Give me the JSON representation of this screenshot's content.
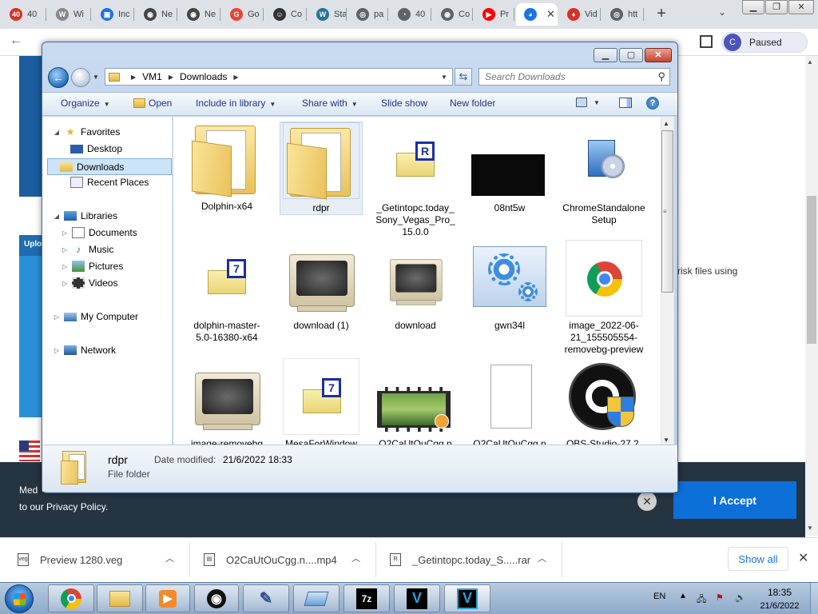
{
  "browser": {
    "tabs": [
      {
        "label": "40",
        "fav": "40",
        "color": "#d93025"
      },
      {
        "label": "Wi",
        "fav": "W",
        "color": "#888888"
      },
      {
        "label": "Inc",
        "fav": "▣",
        "color": "#1a73e8"
      },
      {
        "label": "Ne",
        "fav": "◉",
        "color": "#444444"
      },
      {
        "label": "Ne",
        "fav": "◉",
        "color": "#444444"
      },
      {
        "label": "Go",
        "fav": "G",
        "color": "#ea4335"
      },
      {
        "label": "Co",
        "fav": "☺",
        "color": "#333333"
      },
      {
        "label": "Sta",
        "fav": "W",
        "color": "#21759b"
      },
      {
        "label": "pa",
        "fav": "◎",
        "color": "#5f6368"
      },
      {
        "label": "40",
        "fav": "◔",
        "color": "#5f6368"
      },
      {
        "label": "Co",
        "fav": "◉",
        "color": "#5f6368"
      },
      {
        "label": "Pr",
        "fav": "▶",
        "color": "#ff0000"
      },
      {
        "label": "",
        "fav": "◕",
        "color": "#1a73e8",
        "active": true
      },
      {
        "label": "Vid",
        "fav": "♦",
        "color": "#d93025"
      },
      {
        "label": "htt",
        "fav": "◎",
        "color": "#5f6368"
      }
    ],
    "new_tab_label": "+",
    "profile_initial": "C",
    "profile_status": "Paused"
  },
  "webpage": {
    "side_label": "Uplo",
    "text_fragment": "risk files using",
    "cookie_line1": "Med",
    "cookie_line2": "to our Privacy Policy.",
    "accept_label": "I Accept"
  },
  "explorer": {
    "breadcrumb": [
      "VM1",
      "Downloads"
    ],
    "search_placeholder": "Search Downloads",
    "commands": {
      "organize": "Organize",
      "open": "Open",
      "include_in_library": "Include in library",
      "share_with": "Share with",
      "slide_show": "Slide show",
      "new_folder": "New folder"
    },
    "nav": {
      "favorites": "Favorites",
      "desktop": "Desktop",
      "downloads": "Downloads",
      "recent_places": "Recent Places",
      "libraries": "Libraries",
      "documents": "Documents",
      "music": "Music",
      "pictures": "Pictures",
      "videos": "Videos",
      "my_computer": "My Computer",
      "network": "Network"
    },
    "items": [
      {
        "name": "Dolphin-x64",
        "icon": "folder-icon"
      },
      {
        "name": "rdpr",
        "icon": "folder-icon"
      },
      {
        "name": "_Getintopc.today_Sony_Vegas_Pro_15.0.0",
        "icon": "rar-archive-icon"
      },
      {
        "name": "08nt5w",
        "icon": "image-thumbnail-icon"
      },
      {
        "name": "ChromeStandaloneSetup",
        "icon": "setup-icon"
      },
      {
        "name": "dolphin-master-5.0-16380-x64",
        "icon": "7z-archive-icon"
      },
      {
        "name": "download (1)",
        "icon": "crt-image-icon"
      },
      {
        "name": "download",
        "icon": "crt-image-icon"
      },
      {
        "name": "gwn34l",
        "icon": "gear-image-icon"
      },
      {
        "name": "image_2022-06-21_155505554-removebg-preview",
        "icon": "chrome-image-icon"
      },
      {
        "name": "image-removebg",
        "icon": "crt-image-icon"
      },
      {
        "name": "MesaForWindow",
        "icon": "7z-archive-icon"
      },
      {
        "name": "O2CaUtOuCgg.n",
        "icon": "video-icon"
      },
      {
        "name": "O2CaUtOuCgg.n",
        "icon": "blank-file-icon"
      },
      {
        "name": "OBS-Studio-27.2.",
        "icon": "obs-installer-icon"
      }
    ],
    "details": {
      "name": "rdpr",
      "type": "File folder",
      "date_label": "Date modified:",
      "date_value": "21/6/2022 18:33"
    }
  },
  "downloads_shelf": {
    "items": [
      {
        "name": "Preview 1280.veg",
        "badge": "veg"
      },
      {
        "name": "O2CaUtOuCgg.n....mp4",
        "badge": "▤"
      },
      {
        "name": "_Getintopc.today_S.....rar",
        "badge": "R"
      }
    ],
    "show_all": "Show all"
  },
  "taskbar": {
    "apps": [
      {
        "name": "chrome",
        "glyph": "",
        "color": "#4285f4"
      },
      {
        "name": "explorer",
        "glyph": "",
        "color": "#e3b94a"
      },
      {
        "name": "media-player",
        "glyph": "▶",
        "color": "#f38b2a"
      },
      {
        "name": "obs",
        "glyph": "◉",
        "color": "#111111"
      },
      {
        "name": "pen-tool",
        "glyph": "✎",
        "color": "#2f4f8f"
      },
      {
        "name": "notepad",
        "glyph": "▭",
        "color": "#6aa0d8"
      },
      {
        "name": "7zip",
        "glyph": "7z",
        "color": "#000000"
      },
      {
        "name": "vegas-1",
        "glyph": "V",
        "color": "#2a9fd8"
      },
      {
        "name": "vegas-2",
        "glyph": "V",
        "color": "#2a9fd8"
      }
    ],
    "lang": "EN",
    "time": "18:35",
    "date": "21/6/2022"
  }
}
